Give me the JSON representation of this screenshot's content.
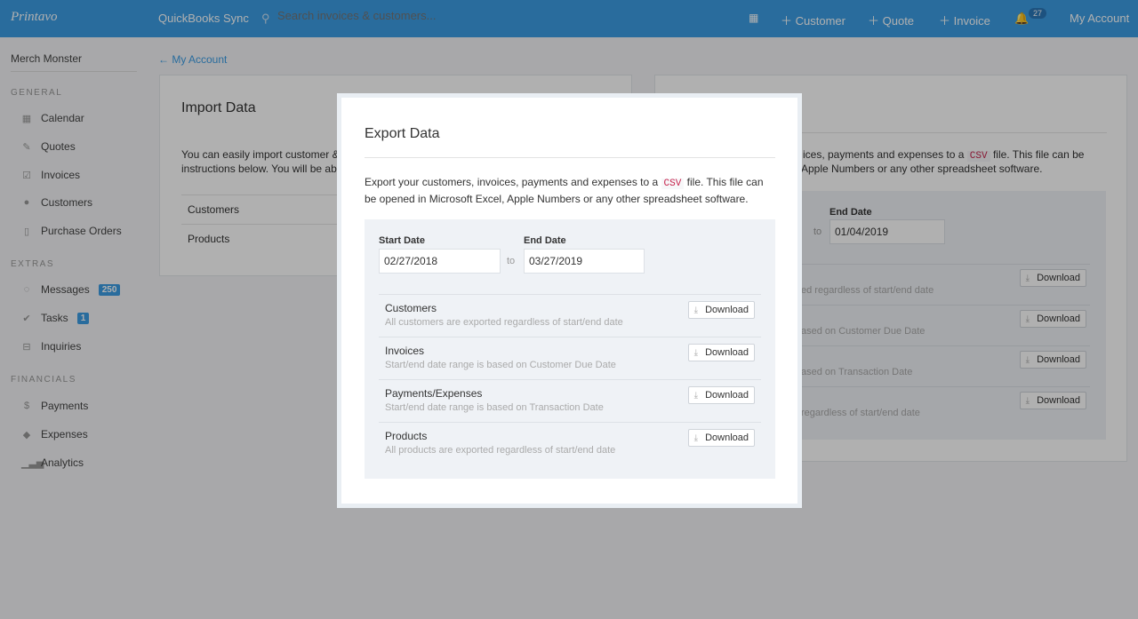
{
  "nav": {
    "logo": "Printavo",
    "quickbooks": "QuickBooks Sync",
    "search_placeholder": "Search invoices & customers...",
    "customer": "Customer",
    "quote": "Quote",
    "invoice": "Invoice",
    "notifications": "27",
    "account": "My Account"
  },
  "sidebar": {
    "company": "Merch Monster",
    "general": "GENERAL",
    "general_items": [
      {
        "label": "Calendar",
        "icon": "calendar-icon"
      },
      {
        "label": "Quotes",
        "icon": "pencil-icon"
      },
      {
        "label": "Invoices",
        "icon": "edit-icon"
      },
      {
        "label": "Customers",
        "icon": "user-icon"
      },
      {
        "label": "Purchase Orders",
        "icon": "document-icon"
      }
    ],
    "extras": "EXTRAS",
    "extras_items": [
      {
        "label": "Messages",
        "badge": "250"
      },
      {
        "label": "Tasks",
        "badge": "1"
      },
      {
        "label": "Inquiries"
      }
    ],
    "financials": "FINANCIALS",
    "financial_items": [
      {
        "label": "Payments"
      },
      {
        "label": "Expenses"
      },
      {
        "label": "Analytics"
      }
    ]
  },
  "breadcrumb": "← My Account",
  "import": {
    "title": "Import Data",
    "text1": "You can easily import customer & p",
    "text2": "instructions below. You will be able",
    "rows": [
      "Customers",
      "Products"
    ]
  },
  "background_export": {
    "text1a": "ices, payments and expenses to a",
    "text1b": "file. This file can be",
    "text2": "Apple Numbers or any other spreadsheet software.",
    "end_label": "End Date",
    "end_value": "01/04/2019",
    "to": "to",
    "rows": [
      "ed regardless of start/end date",
      "ased on Customer Due Date",
      "ased on Transaction Date",
      "regardless of start/end date"
    ],
    "download": "Download"
  },
  "modal": {
    "title": "Export Data",
    "text_a": "Export your customers, invoices, payments and expenses to a",
    "csv": "CSV",
    "text_b": "file. This file can",
    "text_c": "be opened in Microsoft Excel, Apple Numbers or any other spreadsheet software.",
    "start_label": "Start Date",
    "start_value": "02/27/2018",
    "to": "to",
    "end_label": "End Date",
    "end_value": "03/27/2019",
    "download": "Download",
    "rows": [
      {
        "title": "Customers",
        "desc": "All customers are exported regardless of start/end date"
      },
      {
        "title": "Invoices",
        "desc": "Start/end date range is based on Customer Due Date"
      },
      {
        "title": "Payments/Expenses",
        "desc": "Start/end date range is based on Transaction Date"
      },
      {
        "title": "Products",
        "desc": "All products are exported regardless of start/end date"
      }
    ]
  },
  "colors": {
    "brand": "#3c9de4",
    "csv": "#c7254e"
  }
}
